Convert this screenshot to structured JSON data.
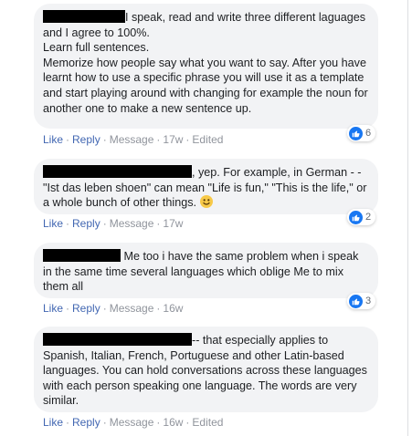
{
  "comments": [
    {
      "text": "I speak, read and write three different laguages and I agree to 100%.\nLearn full sentences.\nMemorize how people say what you want to say. After you have learnt how to use a specific phrase you will use it as a template and start playing around with changing for example the noun for another one to make a new sentence up.",
      "reaction_count": "6",
      "actions": [
        "Like",
        "Reply",
        "Message"
      ],
      "time": "17w",
      "edited": "Edited"
    },
    {
      "text": ", yep. For example, in German - - \"Ist das leben shoen\" can mean \"Life is fun,\" \"This is the life,\" or a whole bunch of other things.",
      "reaction_count": "2",
      "actions": [
        "Like",
        "Reply",
        "Message"
      ],
      "time": "17w"
    },
    {
      "text": "Me too i have the same problem when i speak in the same time several languages which oblige Me to mix them all",
      "reaction_count": "3",
      "actions": [
        "Like",
        "Reply",
        "Message"
      ],
      "time": "16w"
    },
    {
      "text": "-- that especially applies to Spanish, Italian, French, Portuguese and other Latin-based languages. You can hold conversations across these languages with each person speaking one language. The words are very similar.",
      "actions": [
        "Like",
        "Reply",
        "Message"
      ],
      "time": "16w",
      "edited": "Edited"
    }
  ],
  "icons": {
    "reaction": "thumbs-up-icon",
    "emoji": "smiling-face-icon"
  },
  "colors": {
    "bubble": "#f2f3f5",
    "link": "#4267b2",
    "meta": "#90949c",
    "like_badge": "#1877f2",
    "redaction": "#000000"
  }
}
